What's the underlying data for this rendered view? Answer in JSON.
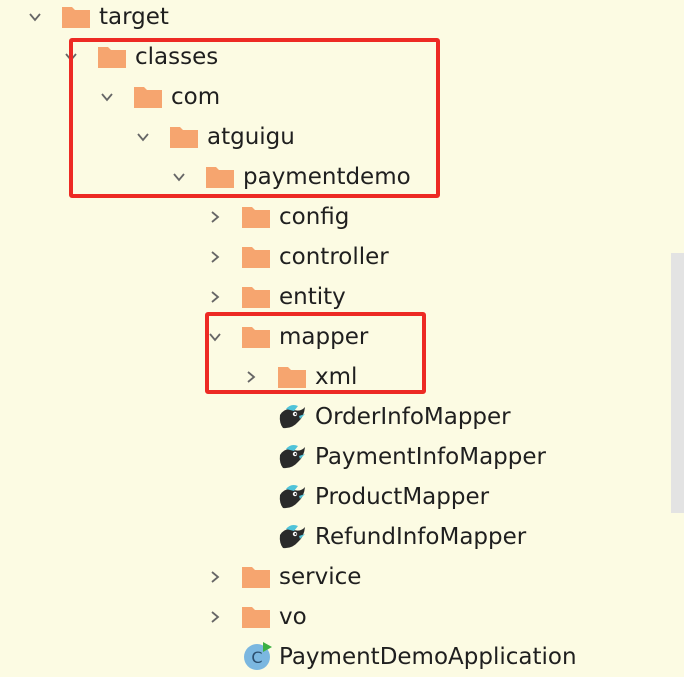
{
  "tree": {
    "target": "target",
    "classes": "classes",
    "com": "com",
    "atguigu": "atguigu",
    "paymentdemo": "paymentdemo",
    "config": "config",
    "controller": "controller",
    "entity": "entity",
    "mapper": "mapper",
    "xml": "xml",
    "order_info_mapper": "OrderInfoMapper",
    "payment_info_mapper": "PaymentInfoMapper",
    "product_mapper": "ProductMapper",
    "refund_info_mapper": "RefundInfoMapper",
    "service": "service",
    "vo": "vo",
    "payment_demo_application": "PaymentDemoApplication"
  },
  "colors": {
    "background": "#FCFBE3",
    "folder": "#F6A56F",
    "highlight": "#ED2A24",
    "mapper_bird": "#2A2A2A",
    "mapper_accent": "#4FC3D9",
    "class_icon": "#7BB7E0",
    "run_badge": "#3CB043"
  },
  "icons": {
    "expanded": "chevron-down-icon",
    "collapsed": "chevron-right-icon",
    "folder": "folder-icon",
    "mapper": "mybatis-mapper-icon",
    "class": "spring-boot-class-icon"
  }
}
